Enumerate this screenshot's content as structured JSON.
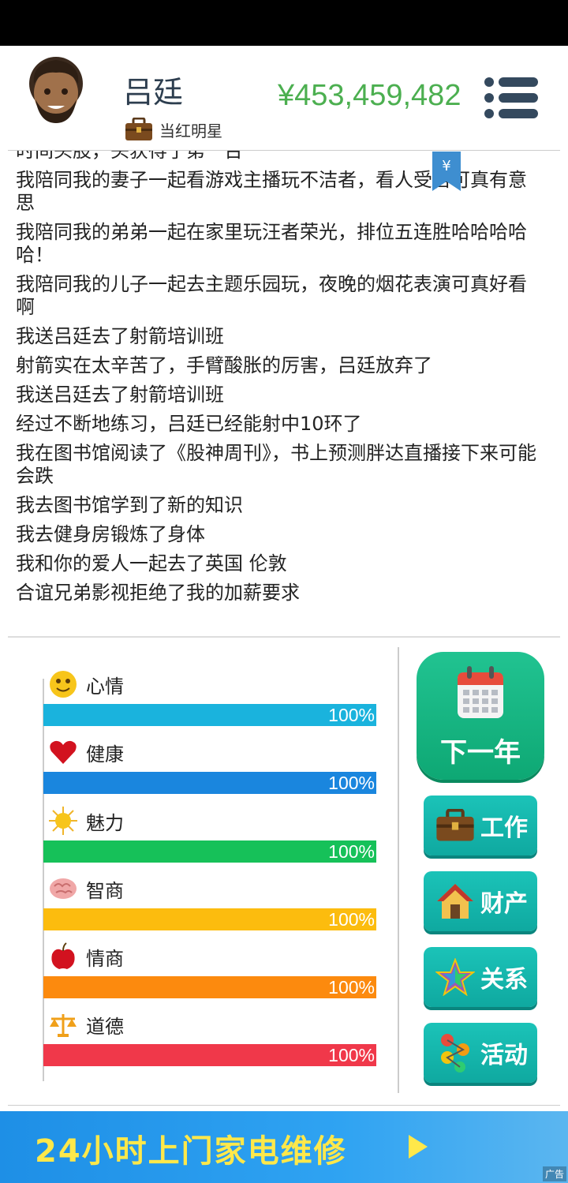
{
  "header": {
    "name": "吕廷",
    "job": "当红明星",
    "money": "¥453,459,482"
  },
  "log": [
    "时间头股，头获得了第一台",
    "我陪同我的妻子一起看游戏主播玩不洁者，看人受苦可真有意思",
    "我陪同我的弟弟一起在家里玩汪者荣光，排位五连胜哈哈哈哈哈！",
    "我陪同我的儿子一起去主题乐园玩，夜晚的烟花表演可真好看啊",
    "我送吕廷去了射箭培训班",
    "射箭实在太辛苦了，手臂酸胀的厉害，吕廷放弃了",
    "我送吕廷去了射箭培训班",
    "经过不断地练习，吕廷已经能射中10环了",
    "我在图书馆阅读了《股神周刊》，书上预测胖达直播接下来可能会跌",
    "我去图书馆学到了新的知识",
    "我去健身房锻炼了身体",
    "我和你的爱人一起去了英国 伦敦",
    "合谊兄弟影视拒绝了我的加薪要求"
  ],
  "bookmark_symbol": "¥",
  "stats": [
    {
      "label": "心情",
      "value": "100%",
      "level": 1.0,
      "color": "#1ab3dd",
      "icon": "smiley-icon"
    },
    {
      "label": "健康",
      "value": "100%",
      "level": 1.0,
      "color": "#1a86de",
      "icon": "heart-icon"
    },
    {
      "label": "魅力",
      "value": "100%",
      "level": 1.0,
      "color": "#16c159",
      "icon": "sun-icon"
    },
    {
      "label": "智商",
      "value": "100%",
      "level": 1.0,
      "color": "#fcbc0e",
      "icon": "brain-icon"
    },
    {
      "label": "情商",
      "value": "100%",
      "level": 1.0,
      "color": "#fc8a0e",
      "icon": "apple-icon"
    },
    {
      "label": "道德",
      "value": "100%",
      "level": 1.0,
      "color": "#f0384a",
      "icon": "scales-icon"
    }
  ],
  "actions": {
    "next_year": "下一年",
    "work": "工作",
    "property": "财产",
    "relations": "关系",
    "activities": "活动"
  },
  "ad": {
    "text": "24小时上门家电维修",
    "tag": "广告"
  }
}
